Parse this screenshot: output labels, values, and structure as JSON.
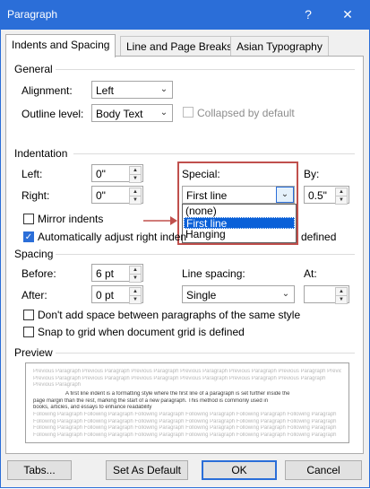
{
  "window": {
    "title": "Paragraph",
    "help": "?",
    "close": "✕"
  },
  "tabs": [
    {
      "label": "Indents and Spacing",
      "active": true
    },
    {
      "label": "Line and Page Breaks"
    },
    {
      "label": "Asian Typography"
    }
  ],
  "general": {
    "heading": "General",
    "alignment_label": "Alignment:",
    "alignment_value": "Left",
    "outline_label": "Outline level:",
    "outline_value": "Body Text",
    "collapsed_label": "Collapsed by default"
  },
  "indentation": {
    "heading": "Indentation",
    "left_label": "Left:",
    "left_value": "0\"",
    "right_label": "Right:",
    "right_value": "0\"",
    "special_label": "Special:",
    "special_value": "First line",
    "by_label": "By:",
    "by_value": "0.5\"",
    "mirror_label": "Mirror indents",
    "auto_adjust_label_start": "Automatically adjust right inden",
    "auto_adjust_label_end": "defined",
    "special_options": [
      "(none)",
      "First line",
      "Hanging"
    ],
    "special_selected": "First line"
  },
  "spacing": {
    "heading": "Spacing",
    "before_label": "Before:",
    "before_value": "6 pt",
    "after_label": "After:",
    "after_value": "0 pt",
    "line_spacing_label": "Line spacing:",
    "line_spacing_value": "Single",
    "at_label": "At:",
    "at_value": "",
    "dont_add_label": "Don't add space between paragraphs of the same style",
    "snap_label": "Snap to grid when document grid is defined"
  },
  "preview": {
    "heading": "Preview",
    "prev_lines": [
      "Previous Paragraph Previous Paragraph Previous Paragraph Previous Paragraph Previous Paragraph Previous Paragraph Previous Paragraph Previous Paragraph",
      "Previous Paragraph Previous Paragraph Previous Paragraph Previous Paragraph Previous Paragraph Previous Paragraph",
      "Previous Paragraph"
    ],
    "body_lines": [
      "A first line indent is a formatting style where the first line of a paragraph is set further inside the",
      "page margin than the rest, marking the start of a new paragraph. This method is commonly used in",
      "books, articles, and essays to enhance readability"
    ],
    "follow_lines": [
      "Following Paragraph Following Paragraph Following Paragraph Following Paragraph Following Paragraph Following Paragraph",
      "Following Paragraph Following Paragraph Following Paragraph Following Paragraph Following Paragraph Following Paragraph",
      "Following Paragraph Following Paragraph Following Paragraph Following Paragraph Following Paragraph Following Paragraph",
      "Following Paragraph Following Paragraph Following Paragraph Following Paragraph Following Paragraph Following Paragraph"
    ]
  },
  "buttons": {
    "tabs": "Tabs...",
    "set_default": "Set As Default",
    "ok": "OK",
    "cancel": "Cancel"
  },
  "colors": {
    "accent": "#2b6ed8",
    "highlight_box": "#c0504d",
    "selection": "#0a60d8"
  },
  "icons": {
    "dropdown": "chevron-down-icon",
    "spin": "spinner-arrows-icon",
    "pointer": "red-arrow-icon"
  }
}
